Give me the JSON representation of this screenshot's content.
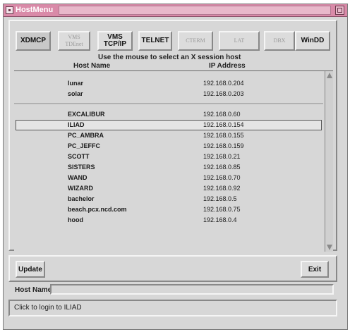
{
  "window": {
    "title": "HostMenu"
  },
  "protocols": [
    {
      "label": "XDMCP",
      "state": "active"
    },
    {
      "label": "VMS\nTDEnet",
      "state": "disabled"
    },
    {
      "label": "VMS\nTCP/IP",
      "state": "enabled"
    },
    {
      "label": "TELNET",
      "state": "enabled"
    },
    {
      "label": "CTERM",
      "state": "disabled"
    },
    {
      "label": "LAT",
      "state": "disabled"
    },
    {
      "label": "DBX",
      "state": "disabled"
    },
    {
      "label": "WinDD",
      "state": "enabled"
    }
  ],
  "instruction": "Use the mouse to select an X session host",
  "columns": {
    "host": "Host Name",
    "ip": "IP Address"
  },
  "hosts_top": [
    {
      "name": "lunar",
      "ip": "192.168.0.204"
    },
    {
      "name": "solar",
      "ip": "192.168.0.203"
    }
  ],
  "hosts": [
    {
      "name": "EXCALIBUR",
      "ip": "192.168.0.60"
    },
    {
      "name": "ILIAD",
      "ip": "192.168.0.154",
      "selected": true
    },
    {
      "name": "PC_AMBRA",
      "ip": "192.168.0.155"
    },
    {
      "name": "PC_JEFFC",
      "ip": "192.168.0.159"
    },
    {
      "name": "SCOTT",
      "ip": "192.168.0.21"
    },
    {
      "name": "SISTERS",
      "ip": "192.168.0.85"
    },
    {
      "name": "WAND",
      "ip": "192.168.0.70"
    },
    {
      "name": "WIZARD",
      "ip": "192.168.0.92"
    },
    {
      "name": "bachelor",
      "ip": "192.168.0.5"
    },
    {
      "name": "beach.pcx.ncd.com",
      "ip": "192.168.0.75"
    },
    {
      "name": "hood",
      "ip": "192.168.0.4"
    }
  ],
  "buttons": {
    "update": "Update",
    "exit": "Exit"
  },
  "hostname": {
    "label": "Host Name",
    "value": ""
  },
  "status": "Click to login to ILIAD"
}
